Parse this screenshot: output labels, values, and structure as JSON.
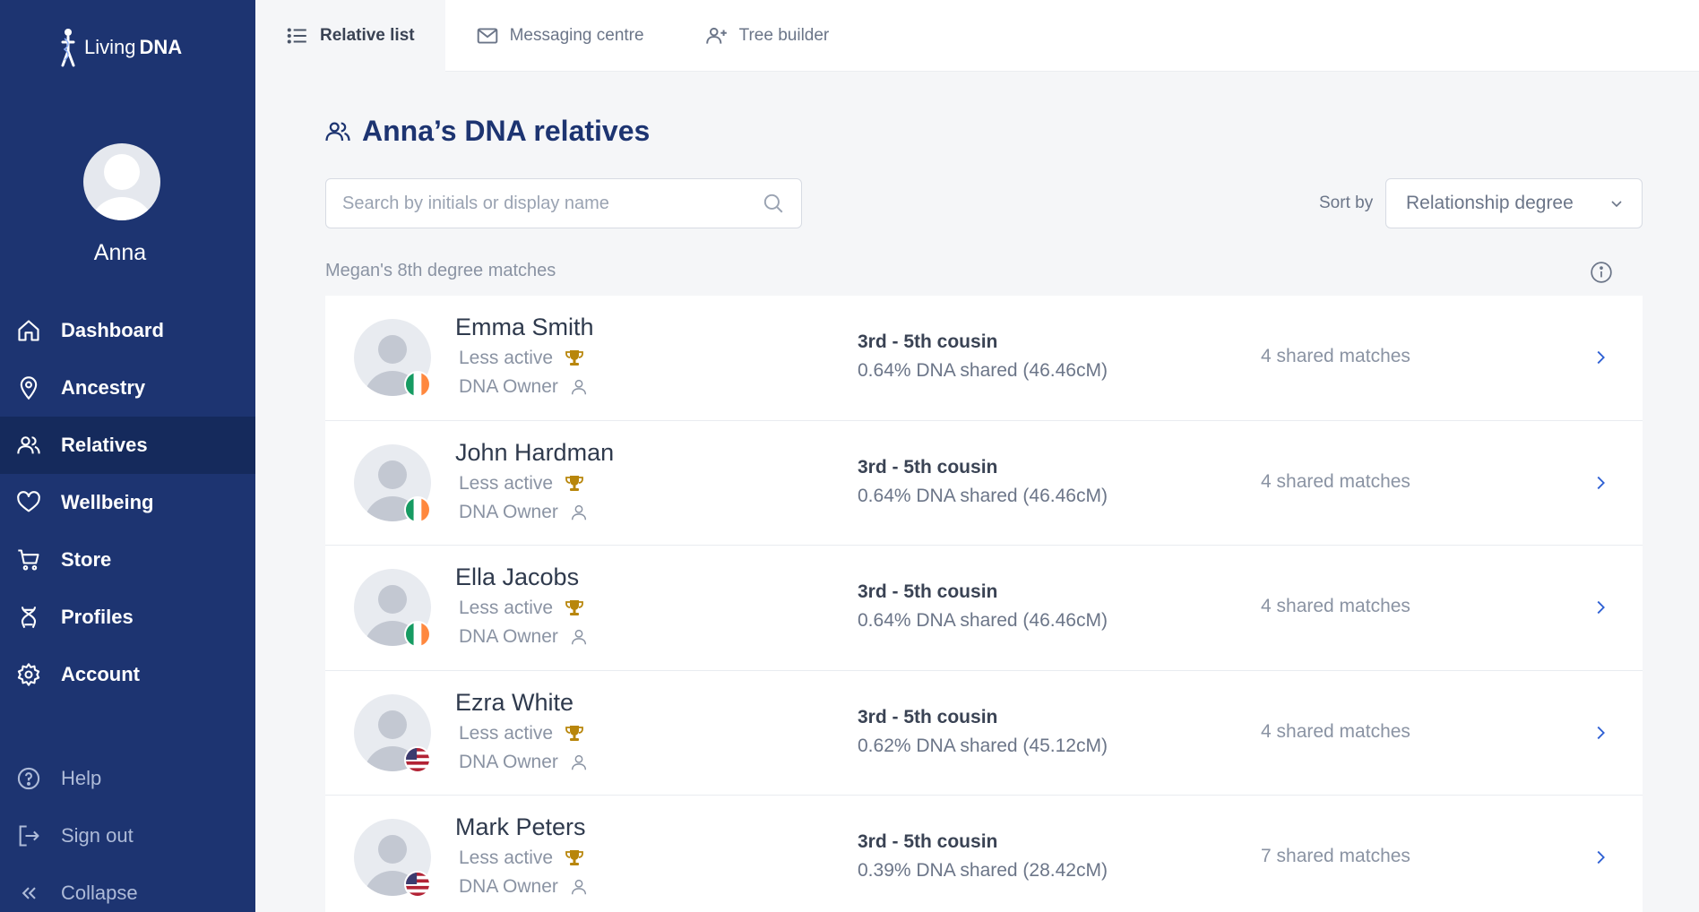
{
  "brand": {
    "word1": "Living",
    "word2": "DNA"
  },
  "user": {
    "name": "Anna"
  },
  "sidebar": {
    "items": [
      {
        "label": "Dashboard",
        "icon": "home-icon"
      },
      {
        "label": "Ancestry",
        "icon": "map-pin-icon"
      },
      {
        "label": "Relatives",
        "icon": "users-icon",
        "active": true
      },
      {
        "label": "Wellbeing",
        "icon": "heart-icon"
      },
      {
        "label": "Store",
        "icon": "cart-icon"
      },
      {
        "label": "Profiles",
        "icon": "dna-icon"
      },
      {
        "label": "Account",
        "icon": "gear-icon"
      }
    ],
    "bottom": [
      {
        "label": "Help",
        "icon": "help-icon"
      },
      {
        "label": "Sign out",
        "icon": "sign-out-icon"
      },
      {
        "label": "Collapse",
        "icon": "double-chevron-left-icon"
      }
    ]
  },
  "tabs": [
    {
      "label": "Relative list",
      "icon": "list-icon",
      "active": true
    },
    {
      "label": "Messaging centre",
      "icon": "mail-icon"
    },
    {
      "label": "Tree builder",
      "icon": "add-person-icon"
    }
  ],
  "main": {
    "title": "Anna’s DNA relatives",
    "search_placeholder": "Search by initials or display name",
    "sort_label": "Sort by",
    "sort_value": "Relationship degree",
    "section_label": "Megan's 8th degree matches"
  },
  "relatives": [
    {
      "name": "Emma Smith",
      "activity": "Less active",
      "owner": "DNA Owner",
      "relationship": "3rd - 5th cousin",
      "dna": "0.64% DNA shared (46.46cM)",
      "shared": "4 shared matches",
      "flag": "ireland"
    },
    {
      "name": "John Hardman",
      "activity": "Less active",
      "owner": "DNA Owner",
      "relationship": "3rd - 5th cousin",
      "dna": "0.64% DNA shared (46.46cM)",
      "shared": "4 shared matches",
      "flag": "ireland"
    },
    {
      "name": "Ella Jacobs",
      "activity": "Less active",
      "owner": "DNA Owner",
      "relationship": "3rd - 5th cousin",
      "dna": "0.64% DNA shared (46.46cM)",
      "shared": "4 shared matches",
      "flag": "ireland"
    },
    {
      "name": "Ezra White",
      "activity": "Less active",
      "owner": "DNA Owner",
      "relationship": "3rd - 5th cousin",
      "dna": "0.62% DNA shared (45.12cM)",
      "shared": "4 shared matches",
      "flag": "usa"
    },
    {
      "name": "Mark Peters",
      "activity": "Less active",
      "owner": "DNA Owner",
      "relationship": "3rd - 5th cousin",
      "dna": "0.39% DNA shared (28.42cM)",
      "shared": "7 shared matches",
      "flag": "usa"
    }
  ],
  "colors": {
    "sidebar": "#1d3471",
    "sidebar_active": "#152a5c",
    "accent": "#2d5fd3",
    "trophy": "#b8860b"
  }
}
